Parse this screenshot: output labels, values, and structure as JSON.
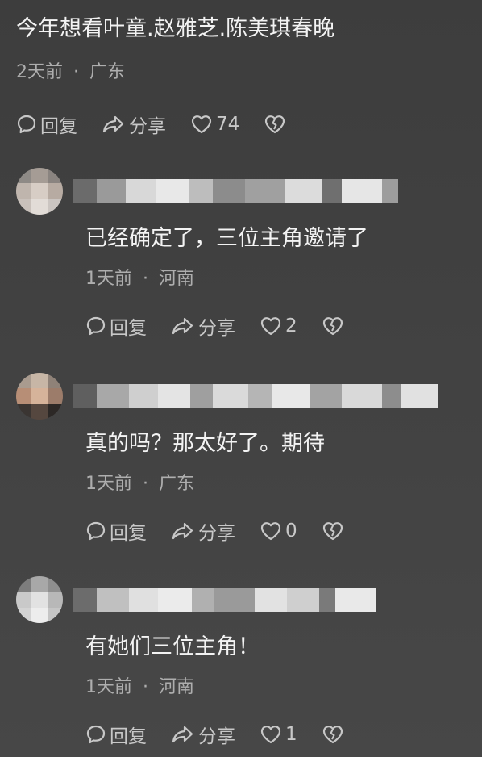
{
  "top_comment": {
    "text": "今年想看叶童.赵雅芝.陈美琪春晚",
    "time": "2天前",
    "separator": "·",
    "location": "广东",
    "reply_label": "回复",
    "share_label": "分享",
    "like_count": "74"
  },
  "replies": [
    {
      "text": "已经确定了，三位主角邀请了",
      "time": "1天前",
      "separator": "·",
      "location": "河南",
      "reply_label": "回复",
      "share_label": "分享",
      "like_count": "2"
    },
    {
      "text": "真的吗？那太好了。期待",
      "time": "1天前",
      "separator": "·",
      "location": "广东",
      "reply_label": "回复",
      "share_label": "分享",
      "like_count": "0"
    },
    {
      "text": "有她们三位主角！",
      "time": "1天前",
      "separator": "·",
      "location": "河南",
      "reply_label": "回复",
      "share_label": "分享",
      "like_count": "1"
    }
  ],
  "colors": {
    "background": "#424242",
    "text": "#f2f2f2",
    "meta_text": "#aeaeae",
    "action_text": "#c8c8c8"
  },
  "icons": {
    "reply": "speech-bubble-icon",
    "share": "share-arrow-icon",
    "like": "heart-icon",
    "dislike": "broken-heart-icon"
  }
}
